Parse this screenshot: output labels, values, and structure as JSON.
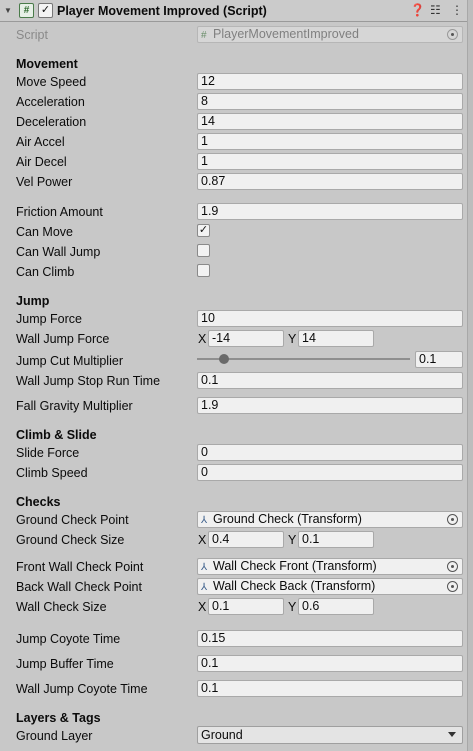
{
  "header": {
    "title": "Player Movement Improved (Script)",
    "enabled": true
  },
  "script_row": {
    "label": "Script",
    "value": "PlayerMovementImproved"
  },
  "sections": {
    "movement": "Movement",
    "jump": "Jump",
    "climb": "Climb & Slide",
    "checks": "Checks",
    "layers": "Layers & Tags"
  },
  "fields": {
    "move_speed": {
      "label": "Move Speed",
      "value": "12"
    },
    "acceleration": {
      "label": "Acceleration",
      "value": "8"
    },
    "deceleration": {
      "label": "Deceleration",
      "value": "14"
    },
    "air_accel": {
      "label": "Air Accel",
      "value": "1"
    },
    "air_decel": {
      "label": "Air Decel",
      "value": "1"
    },
    "vel_power": {
      "label": "Vel Power",
      "value": "0.87"
    },
    "friction_amount": {
      "label": "Friction Amount",
      "value": "1.9"
    },
    "can_move": {
      "label": "Can Move",
      "checked": true
    },
    "can_wall_jump": {
      "label": "Can Wall Jump",
      "checked": false
    },
    "can_climb": {
      "label": "Can Climb",
      "checked": false
    },
    "jump_force": {
      "label": "Jump Force",
      "value": "10"
    },
    "wall_jump_force": {
      "label": "Wall Jump Force",
      "x": "-14",
      "y": "14"
    },
    "jump_cut_multiplier": {
      "label": "Jump Cut Multiplier",
      "value": "0.1"
    },
    "wall_jump_stop_run_time": {
      "label": "Wall Jump Stop Run Time",
      "value": "0.1"
    },
    "fall_gravity_multiplier": {
      "label": "Fall Gravity Multiplier",
      "value": "1.9"
    },
    "slide_force": {
      "label": "Slide Force",
      "value": "0"
    },
    "climb_speed": {
      "label": "Climb Speed",
      "value": "0"
    },
    "ground_check_point": {
      "label": "Ground Check Point",
      "value": "Ground Check (Transform)"
    },
    "ground_check_size": {
      "label": "Ground Check Size",
      "x": "0.4",
      "y": "0.1"
    },
    "front_wall_check_point": {
      "label": "Front Wall Check Point",
      "value": "Wall Check Front (Transform)"
    },
    "back_wall_check_point": {
      "label": "Back Wall Check Point",
      "value": "Wall Check Back (Transform)"
    },
    "wall_check_size": {
      "label": "Wall Check Size",
      "x": "0.1",
      "y": "0.6"
    },
    "jump_coyote_time": {
      "label": "Jump Coyote Time",
      "value": "0.15"
    },
    "jump_buffer_time": {
      "label": "Jump Buffer Time",
      "value": "0.1"
    },
    "wall_jump_coyote_time": {
      "label": "Wall Jump Coyote Time",
      "value": "0.1"
    },
    "ground_layer": {
      "label": "Ground Layer",
      "value": "Ground"
    }
  },
  "vector_axis": {
    "x": "X",
    "y": "Y"
  },
  "slider": {
    "min": 0,
    "max": 1,
    "fraction": 0.1
  },
  "icons": {
    "foldout": "triangle-down-icon",
    "script": "script-hash-icon",
    "help": "help-icon",
    "presets": "sliders-icon",
    "menu": "kebab-menu-icon",
    "transform": "transform-icon",
    "object_picker": "target-icon"
  },
  "colors": {
    "panel": "#c8c8c8",
    "field": "#f0f0f0",
    "border": "#a9a9a9"
  }
}
